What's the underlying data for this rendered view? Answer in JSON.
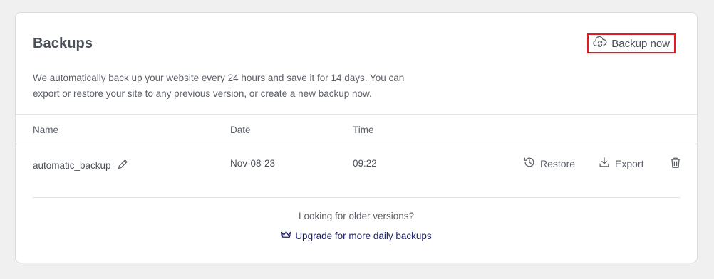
{
  "card": {
    "title": "Backups",
    "backup_now_label": "Backup now",
    "description": "We automatically back up your website every 24 hours and save it for 14 days. You can export or restore your site to any previous version, or create a new backup now."
  },
  "table": {
    "columns": [
      "Name",
      "Date",
      "Time"
    ],
    "rows": [
      {
        "name": "automatic_backup",
        "date": "Nov-08-23",
        "time": "09:22",
        "restore_label": "Restore",
        "export_label": "Export"
      }
    ]
  },
  "footer": {
    "older_text": "Looking for older versions?",
    "upgrade_label": "Upgrade for more daily backups"
  },
  "icons": {
    "backup": "cloud-sync-icon",
    "edit": "pencil-icon",
    "restore": "history-icon",
    "export": "download-icon",
    "delete": "trash-icon",
    "upgrade": "crown-icon"
  },
  "colors": {
    "highlight_border": "#e01b24",
    "link": "#1a1f6e"
  }
}
